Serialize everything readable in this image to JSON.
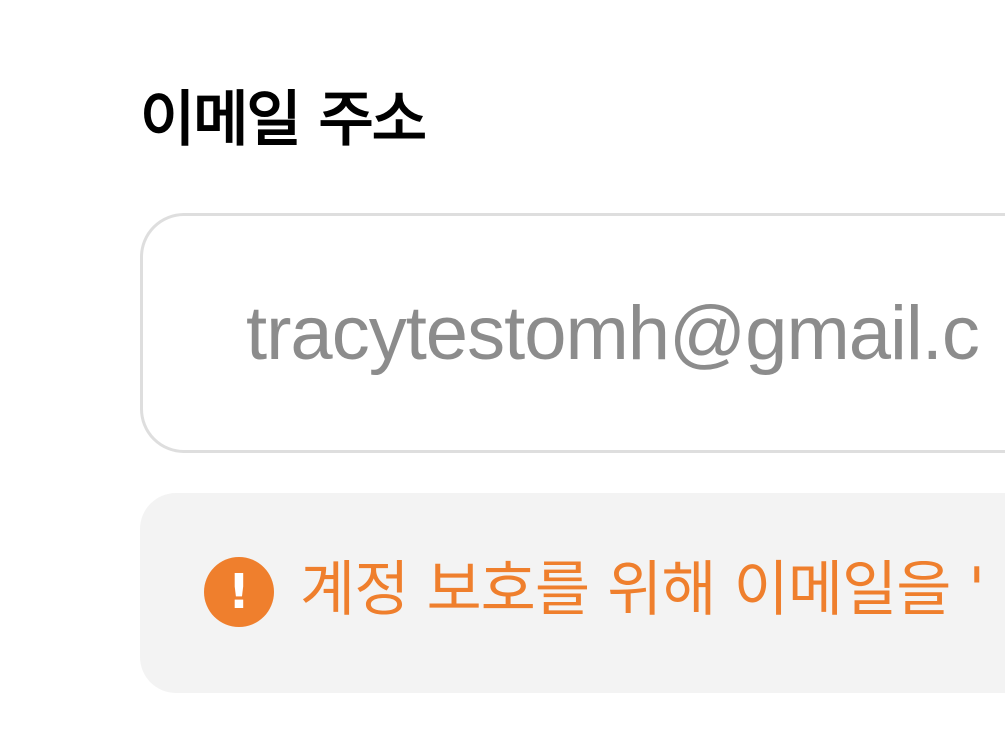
{
  "form": {
    "email_label": "이메일 주소",
    "email_value": "tracytestomh@gmail.c"
  },
  "notice": {
    "icon": "exclamation-circle-icon",
    "icon_glyph": "!",
    "text": "계정 보호를 위해 이메일을 '",
    "color": "#ef7f2d"
  }
}
